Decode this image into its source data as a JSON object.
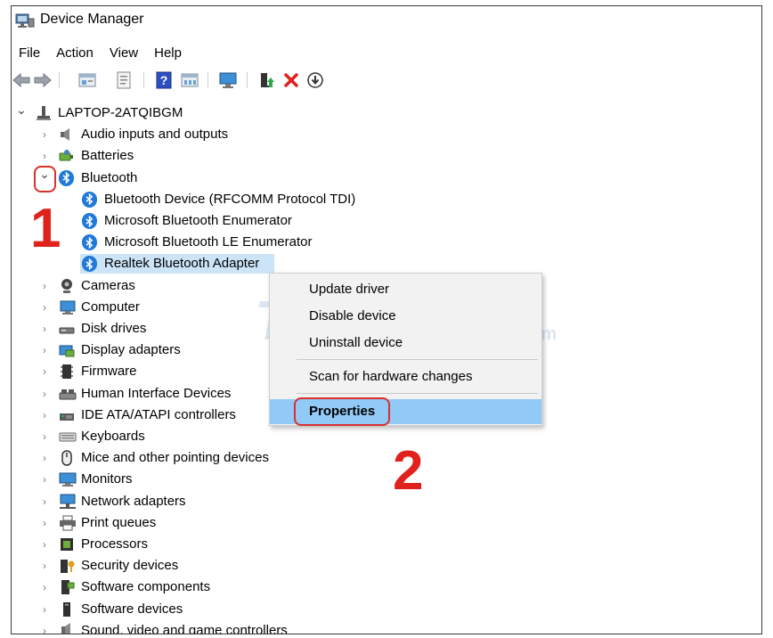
{
  "window": {
    "title": "Device Manager"
  },
  "menu": [
    "File",
    "Action",
    "View",
    "Help"
  ],
  "toolbar": {
    "icons": [
      "back-arrow-icon",
      "forward-arrow-icon",
      "properties-icon",
      "details-icon",
      "help-icon",
      "resources-icon",
      "monitor-scan-icon",
      "add-driver-icon",
      "uninstall-x-icon",
      "update-driver-icon"
    ]
  },
  "tree": {
    "root": "LAPTOP-2ATQIBGM",
    "items_before": [
      {
        "label": "Audio inputs and outputs",
        "icon": "speaker-icon"
      },
      {
        "label": "Batteries",
        "icon": "battery-icon"
      }
    ],
    "bluetooth": {
      "label": "Bluetooth",
      "children": [
        "Bluetooth Device (RFCOMM Protocol TDI)",
        "Microsoft Bluetooth Enumerator",
        "Microsoft Bluetooth LE Enumerator",
        "Realtek Bluetooth Adapter"
      ]
    },
    "items_after": [
      {
        "label": "Cameras",
        "icon": "camera-icon"
      },
      {
        "label": "Computer",
        "icon": "computer-icon"
      },
      {
        "label": "Disk drives",
        "icon": "disk-drive-icon"
      },
      {
        "label": "Display adapters",
        "icon": "display-adapter-icon"
      },
      {
        "label": "Firmware",
        "icon": "firmware-icon"
      },
      {
        "label": "Human Interface Devices",
        "icon": "hid-icon"
      },
      {
        "label": "IDE ATA/ATAPI controllers",
        "icon": "ide-controller-icon"
      },
      {
        "label": "Keyboards",
        "icon": "keyboard-icon"
      },
      {
        "label": "Mice and other pointing devices",
        "icon": "mouse-icon"
      },
      {
        "label": "Monitors",
        "icon": "monitor-icon"
      },
      {
        "label": "Network adapters",
        "icon": "network-adapter-icon"
      },
      {
        "label": "Print queues",
        "icon": "printer-icon"
      },
      {
        "label": "Processors",
        "icon": "processor-icon"
      },
      {
        "label": "Security devices",
        "icon": "security-device-icon"
      },
      {
        "label": "Software components",
        "icon": "software-component-icon"
      },
      {
        "label": "Software devices",
        "icon": "software-device-icon"
      },
      {
        "label": "Sound, video and game controllers",
        "icon": "sound-controller-icon"
      }
    ]
  },
  "context_menu": {
    "items": [
      "Update driver",
      "Disable device",
      "Uninstall device",
      "Scan for hardware changes",
      "Properties"
    ],
    "highlighted": "Properties"
  },
  "annotations": {
    "step1": "1",
    "step2": "2",
    "color": "#e0211c"
  },
  "watermark": {
    "text": "TipsMake",
    "suffix": ".com"
  },
  "colors": {
    "selection": "#cce4f7",
    "menu_highlight": "#91c9f7",
    "bluetooth": "#1f7ad9"
  }
}
